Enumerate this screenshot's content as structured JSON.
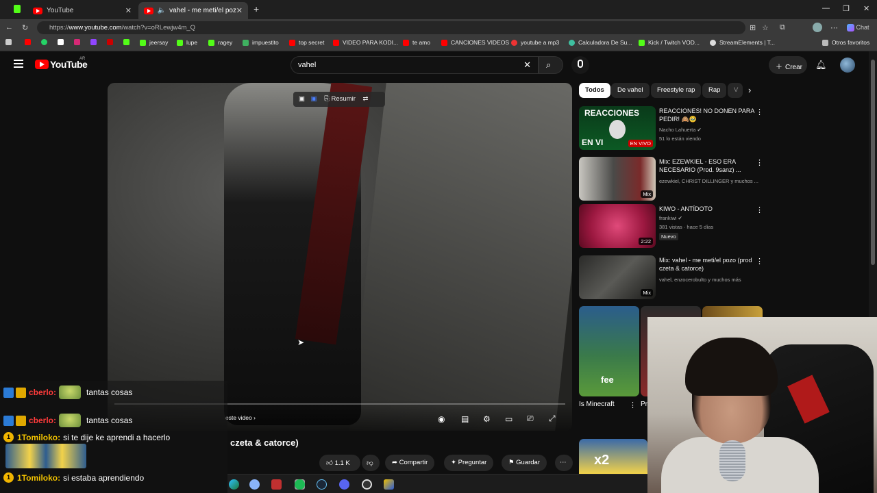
{
  "browser": {
    "tabs": [
      {
        "label": "YouTube"
      },
      {
        "label": "vahel - me meti/el pozo (prod"
      }
    ],
    "url_prefix": "https://",
    "url_host": "www.youtube.com",
    "url_path": "/watch?v=oRLewjw4m_Q",
    "chat_label": "Chat",
    "bookmarks": [
      "jeersay",
      "lupe",
      "ragey",
      "impuestito",
      "top secret",
      "VIDEO PARA KODI...",
      "te amo",
      "CANCIONES VIDEOS",
      "youtube a mp3",
      "Calculadora De Su...",
      "Kick / Twitch VOD...",
      "StreamElements | T...",
      "Otros favoritos"
    ]
  },
  "youtube": {
    "logo_text": "YouTube",
    "country": "AR",
    "search_value": "vahel",
    "create_label": "Crear",
    "player": {
      "resumir_label": "Resumir",
      "cards_text": "este video"
    },
    "video_title": "czeta & catorce)",
    "actions": {
      "likes": "1.1 K",
      "share": "Compartir",
      "ask": "Preguntar",
      "save": "Guardar"
    },
    "chips": [
      "Todos",
      "De vahel",
      "Freestyle rap",
      "Rap",
      "V"
    ],
    "recommendations": [
      {
        "title": "REACCIONES! NO DONEN PARA PEDIR! 🙈🥹",
        "channel": "Nacho Lahuerta",
        "meta": "51 lo están viendo",
        "badge": "EN VIVO",
        "thumb_text": "REACCIONES",
        "thumb_text2": "EN VI"
      },
      {
        "title": "Mix: EZEWKIEL - ESO ERA NECESARIO (Prod. 9sanz) ...",
        "channel": "ezewkiel, CHRIST DILLINGER y muchos ...",
        "meta": "",
        "badge": "Mix"
      },
      {
        "title": "KIWO - ANTÍDOTO",
        "channel": "frankiwi",
        "meta": "381 vistas · hace 5 días",
        "badge": "2:22",
        "tag": "Nuevo"
      },
      {
        "title": "Mix: vahel - me meti/el pozo (prod czeta & catorce)",
        "channel": "vahel, enzocerobulto y muchos más",
        "meta": "",
        "badge": "Mix"
      }
    ],
    "shorts": [
      {
        "title": "Is Minecraft",
        "thumb_text": "fee"
      },
      {
        "title": "Pr",
        "thumb_text": ""
      }
    ],
    "short_bottom_text": "x2"
  },
  "chat": [
    {
      "user": "cberlo:",
      "message": "tantas cosas"
    },
    {
      "user": "cberlo:",
      "message": "tantas cosas"
    },
    {
      "user": "1Tomiloko:",
      "message": "si te dije ke aprendi a hacerlo",
      "badge": "1"
    },
    {
      "user": "1Tomiloko:",
      "message": "si estaba aprendiendo",
      "badge": "1"
    }
  ],
  "colors": {
    "yt_red": "#ff0000",
    "bg": "#0f0f0f",
    "chip_bg": "#272727",
    "chat_red": "#ff3b3b",
    "chat_yellow": "#f2c200"
  }
}
